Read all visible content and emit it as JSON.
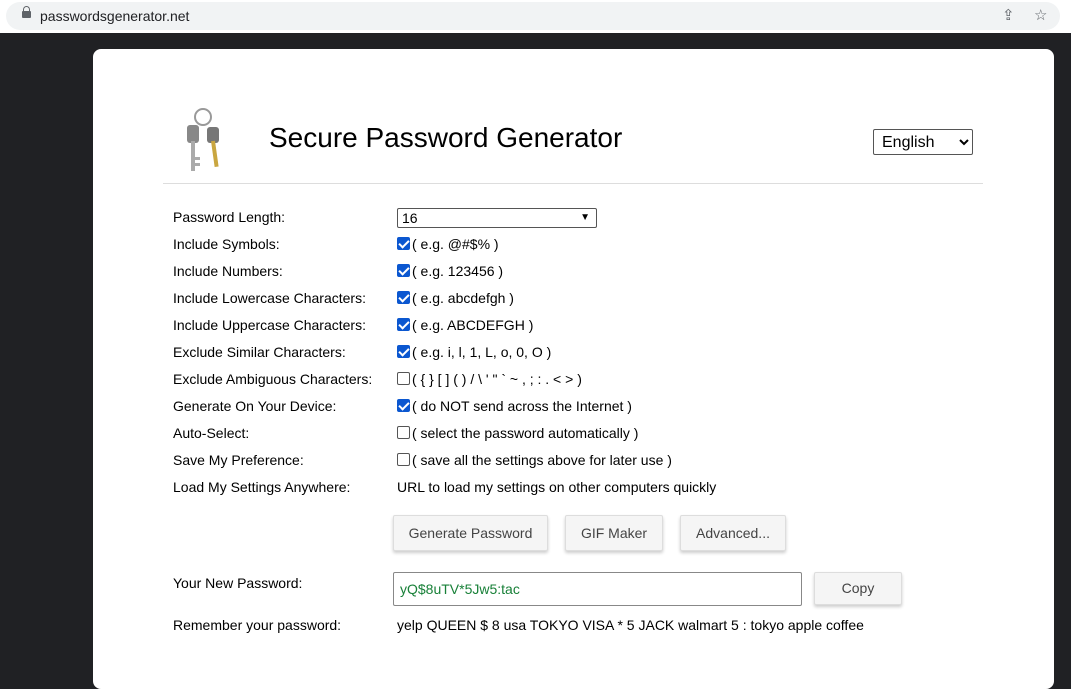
{
  "browser": {
    "url": "passwordsgenerator.net"
  },
  "header": {
    "title": "Secure Password Generator",
    "language": "English"
  },
  "form": {
    "length_label": "Password Length:",
    "length_value": "16",
    "options": [
      {
        "label": "Include Symbols:",
        "hint": "( e.g. @#$% )",
        "checked": true
      },
      {
        "label": "Include Numbers:",
        "hint": "( e.g. 123456 )",
        "checked": true
      },
      {
        "label": "Include Lowercase Characters:",
        "hint": "( e.g. abcdefgh )",
        "checked": true
      },
      {
        "label": "Include Uppercase Characters:",
        "hint": "( e.g. ABCDEFGH )",
        "checked": true
      },
      {
        "label": "Exclude Similar Characters:",
        "hint": "( e.g. i, l, 1, L, o, 0, O )",
        "checked": true
      },
      {
        "label": "Exclude Ambiguous Characters:",
        "hint": "( { } [ ] ( ) / \\ ' \" ` ~ , ; : . < > )",
        "checked": false
      },
      {
        "label": "Generate On Your Device:",
        "hint": "( do NOT send across the Internet )",
        "checked": true
      },
      {
        "label": "Auto-Select:",
        "hint": "( select the password automatically )",
        "checked": false
      },
      {
        "label": "Save My Preference:",
        "hint": "( save all the settings above for later use )",
        "checked": false
      }
    ],
    "load_label": "Load My Settings Anywhere:",
    "load_link": "URL to load my settings on other computers quickly",
    "buttons": {
      "generate": "Generate Password",
      "gif": "GIF Maker",
      "advanced": "Advanced..."
    },
    "new_password_label": "Your New Password:",
    "new_password": "yQ$8uTV*5Jw5:tac",
    "copy": "Copy",
    "remember_label": "Remember your password:",
    "remember_text": "yelp QUEEN $ 8 usa TOKYO VISA * 5 JACK walmart 5 : tokyo apple coffee"
  }
}
